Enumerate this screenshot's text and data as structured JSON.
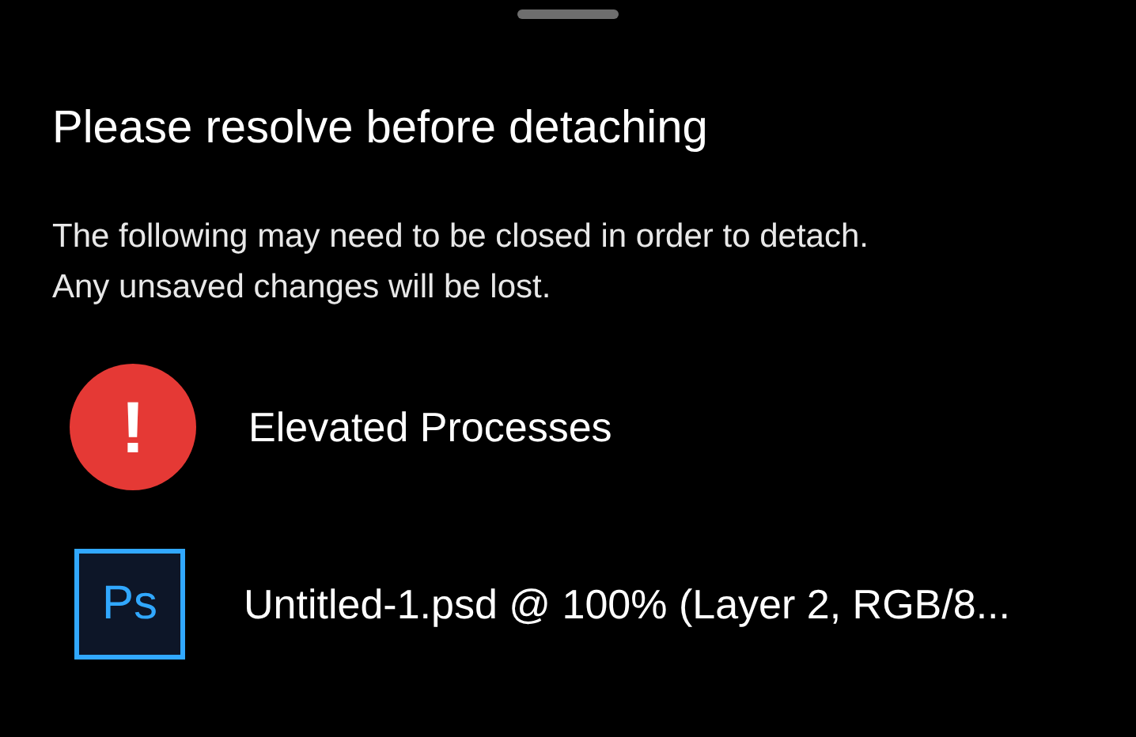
{
  "title": "Please resolve before detaching",
  "description": [
    "The following may need to be closed in order to detach.",
    "Any unsaved changes will be lost."
  ],
  "items": [
    {
      "kind": "warning",
      "icon_text": "!",
      "label": "Elevated Processes"
    },
    {
      "kind": "app",
      "icon_text": "Ps",
      "label": "Untitled-1.psd @ 100% (Layer 2, RGB/8..."
    }
  ]
}
